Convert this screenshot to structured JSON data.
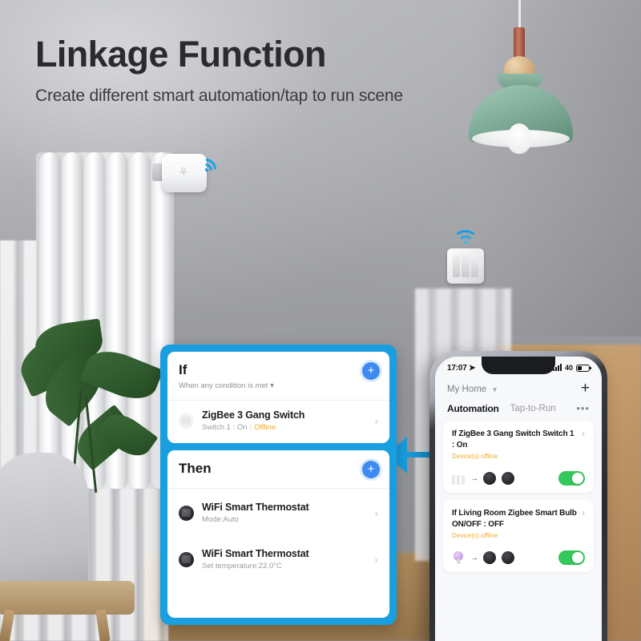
{
  "hero": {
    "title": "Linkage Function",
    "subtitle": "Create different smart automation/tap to run scene"
  },
  "scene": {
    "radiator_valve_icon": "smart-radiator-valve",
    "wall_switch_icon": "3-gang-wall-switch",
    "pendant_lamp_icon": "pendant-lamp",
    "plant_icon": "potted-plant",
    "chair_icon": "armchair",
    "wifi_signal_icon": "wifi-signal"
  },
  "automation_card": {
    "if_panel": {
      "title": "If",
      "subtitle": "When any condition is met",
      "add_label": "+",
      "rows": [
        {
          "name": "ZigBee 3 Gang Switch",
          "state": "Switch 1 : On",
          "status": "Offline",
          "chevron": "›"
        }
      ]
    },
    "then_panel": {
      "title": "Then",
      "add_label": "+",
      "rows": [
        {
          "name": "WiFi Smart Thermostat",
          "meta": "Mode:Auto",
          "chevron": "›"
        },
        {
          "name": "WiFi Smart Thermostat",
          "meta": "Set temperature:22.0°C",
          "chevron": "›"
        }
      ]
    }
  },
  "phone": {
    "status_bar": {
      "time": "17:07",
      "location_icon": "location-arrow",
      "signal_icon": "signal-bars",
      "battery_percent": "40",
      "battery_icon": "battery"
    },
    "header": {
      "home_name": "My Home",
      "caret_icon": "chevron-down-icon",
      "add_icon": "+"
    },
    "tabs": [
      {
        "label": "Automation",
        "active": true
      },
      {
        "label": "Tap-to-Run",
        "active": false
      }
    ],
    "more_icon": "•••",
    "automations": [
      {
        "title": "If ZigBee 3 Gang Switch Switch 1 : On",
        "status": "Device(s) offline",
        "chevron": "›",
        "source_icon": "wall-switch-icon",
        "link_icon": "→",
        "target_icons": [
          "thermostat-icon",
          "thermostat-icon"
        ],
        "enabled": true
      },
      {
        "title": "If  Living Room Zigbee Smart Bulb ON/OFF : OFF",
        "status": "Device(s) offline",
        "chevron": "›",
        "source_icon": "bulb-icon",
        "link_icon": "→",
        "target_icons": [
          "thermostat-icon",
          "thermostat-icon"
        ],
        "enabled": true
      }
    ]
  },
  "colors": {
    "accent_blue": "#199ee0",
    "plus_blue": "#3d8bf0",
    "warning_amber": "#efab28",
    "toggle_green": "#34c759"
  }
}
